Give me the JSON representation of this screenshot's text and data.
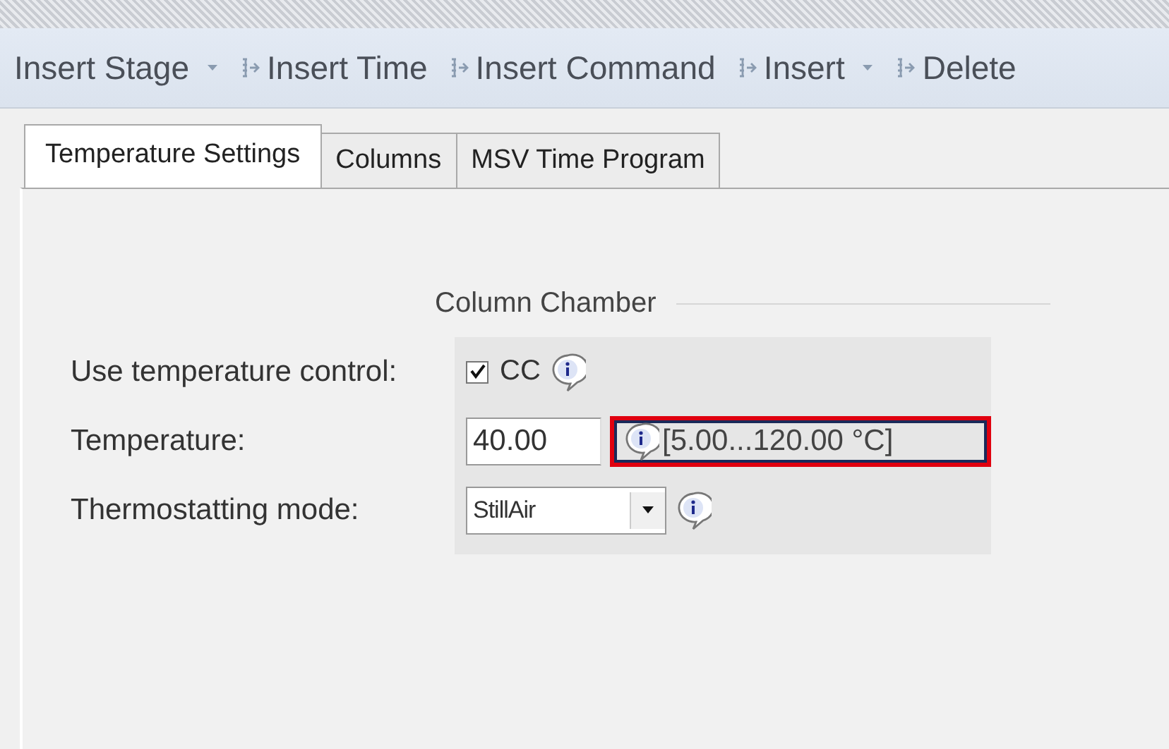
{
  "toolbar": [
    {
      "label": "Insert Stage",
      "icon": false,
      "has_menu": true
    },
    {
      "label": "Insert Time",
      "icon": true,
      "has_menu": false
    },
    {
      "label": "Insert Command",
      "icon": true,
      "has_menu": false
    },
    {
      "label": "Insert",
      "icon": true,
      "has_menu": true
    },
    {
      "label": "Delete",
      "icon": true,
      "has_menu": false
    }
  ],
  "tabs": [
    {
      "label": "Temperature Settings",
      "selected": true
    },
    {
      "label": "Columns",
      "selected": false
    },
    {
      "label": "MSV Time Program",
      "selected": false
    }
  ],
  "group": {
    "title": "Column Chamber",
    "rows": [
      {
        "kind": "checkbox",
        "label": "Use temperature control:",
        "checked": true,
        "text": "CC"
      },
      {
        "kind": "number",
        "label": "Temperature:",
        "value": "40.00",
        "range": "[5.00...120.00 °C]",
        "highlighted": true
      },
      {
        "kind": "dropdown",
        "label": "Thermostatting mode:",
        "value": "StillAir"
      }
    ]
  }
}
